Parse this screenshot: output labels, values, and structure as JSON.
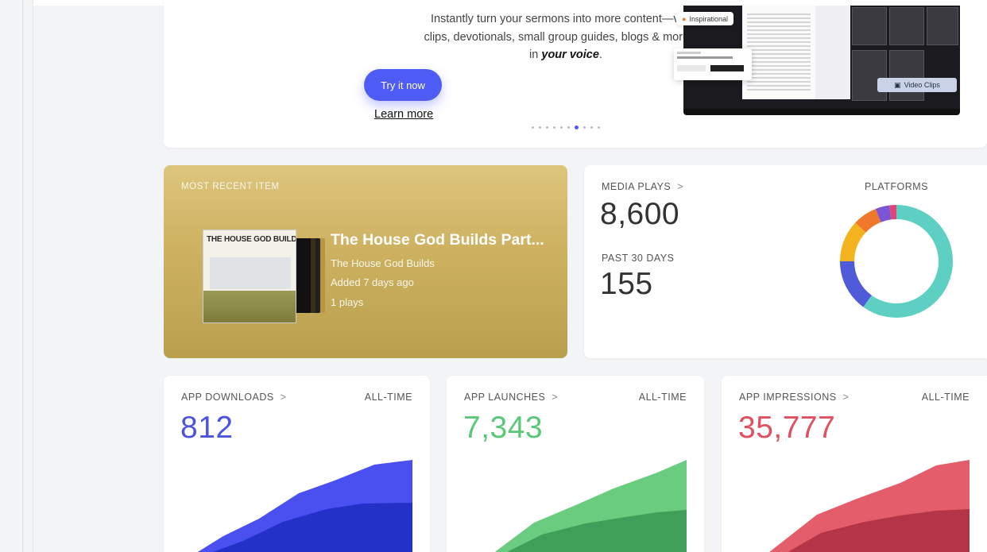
{
  "promo": {
    "line1": "Instantly turn your sermons into more content—video",
    "line2": "clips, devotionals, small group guides, blogs & more. All",
    "line3_prefix": "in ",
    "line3_em": "your voice",
    "line3_suffix": ".",
    "cta_label": "Try it now",
    "learn_label": "Learn more",
    "tag_label": "Inspirational",
    "video_tag_label": "Video Clips",
    "slide_count": 10,
    "active_slide": 7
  },
  "recent": {
    "label": "MOST RECENT ITEM",
    "cover_text": "THE HOUSE GOD BUILDS",
    "title": "The House God Builds Part...",
    "series": "The House God Builds",
    "added": "Added 7 days ago",
    "plays": "1 plays"
  },
  "media": {
    "label": "MEDIA PLAYS",
    "chevron": ">",
    "value": "8,600",
    "period_label": "PAST 30 DAYS",
    "period_value": "155",
    "platforms_label": "PLATFORMS",
    "platforms": [
      {
        "color": "#5ecfc3",
        "value": 60
      },
      {
        "color": "#4f5bd8",
        "value": 15
      },
      {
        "color": "#f2b31f",
        "value": 12
      },
      {
        "color": "#f0782a",
        "value": 7
      },
      {
        "color": "#7a55d6",
        "value": 4
      },
      {
        "color": "#e0457a",
        "value": 2
      }
    ]
  },
  "stats": [
    {
      "label": "APP DOWNLOADS",
      "chevron": ">",
      "period": "ALL-TIME",
      "value": "812",
      "color": "#4b53e0",
      "area_light": "#4a50f0",
      "area_dark": "#2331c9"
    },
    {
      "label": "APP LAUNCHES",
      "chevron": ">",
      "period": "ALL-TIME",
      "value": "7,343",
      "color": "#5ac878",
      "area_light": "#69cc7f",
      "area_dark": "#3f9f58"
    },
    {
      "label": "APP IMPRESSIONS",
      "chevron": ">",
      "period": "ALL-TIME",
      "value": "35,777",
      "color": "#e0505f",
      "area_light": "#e35d6a",
      "area_dark": "#b63448"
    }
  ]
}
